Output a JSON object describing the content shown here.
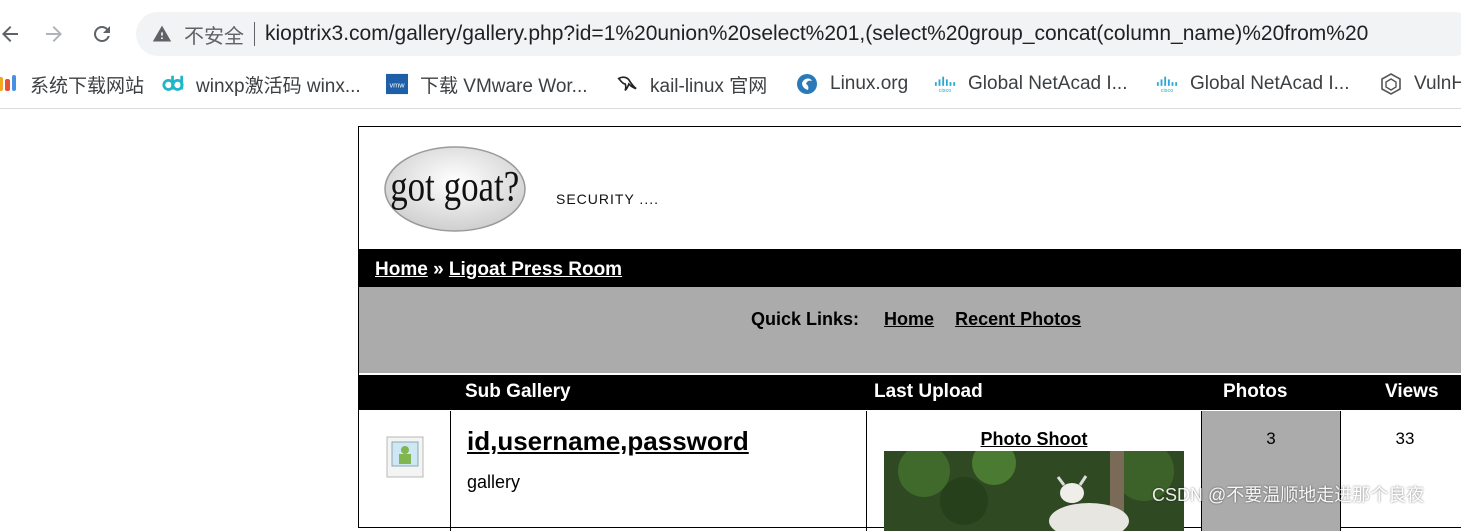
{
  "browser": {
    "security_label": "不安全",
    "url": "kioptrix3.com/gallery/gallery.php?id=1%20union%20select%201,(select%20group_concat(column_name)%20from%20"
  },
  "bookmarks": [
    {
      "label": "系统下载网站",
      "icon": "colorful-logo-icon"
    },
    {
      "label": "winxp激活码 winx...",
      "icon": "dd-logo-icon"
    },
    {
      "label": "下载 VMware Wor...",
      "icon": "vmware-icon"
    },
    {
      "label": "kail-linux 官网",
      "icon": "kali-dragon-icon"
    },
    {
      "label": "Linux.org",
      "icon": "linux-org-icon"
    },
    {
      "label": "Global NetAcad I...",
      "icon": "cisco-icon"
    },
    {
      "label": "Global NetAcad I...",
      "icon": "cisco-icon"
    },
    {
      "label": "VulnH",
      "icon": "vulnhub-icon"
    }
  ],
  "site": {
    "logo_text": "got goat?",
    "tagline": "SECURITY ....",
    "breadcrumb": {
      "home": "Home",
      "sep": " » ",
      "current": "Ligoat Press Room"
    },
    "quicklinks": {
      "label": "Quick Links:",
      "home": "Home",
      "recent": "Recent Photos"
    },
    "table": {
      "headers": {
        "sub_gallery": "Sub Gallery",
        "last_upload": "Last Upload",
        "photos": "Photos",
        "views": "Views"
      },
      "rows": [
        {
          "title": "id,username,password",
          "subtitle": "gallery",
          "last_upload_title": "Photo Shoot",
          "photos": "3",
          "views": "33"
        }
      ]
    },
    "colors": {
      "bar": "#000000",
      "quicklinks_bg": "#ababab",
      "photos_col": "#ababab"
    }
  },
  "watermark": "CSDN @不要温顺地走进那个良夜"
}
